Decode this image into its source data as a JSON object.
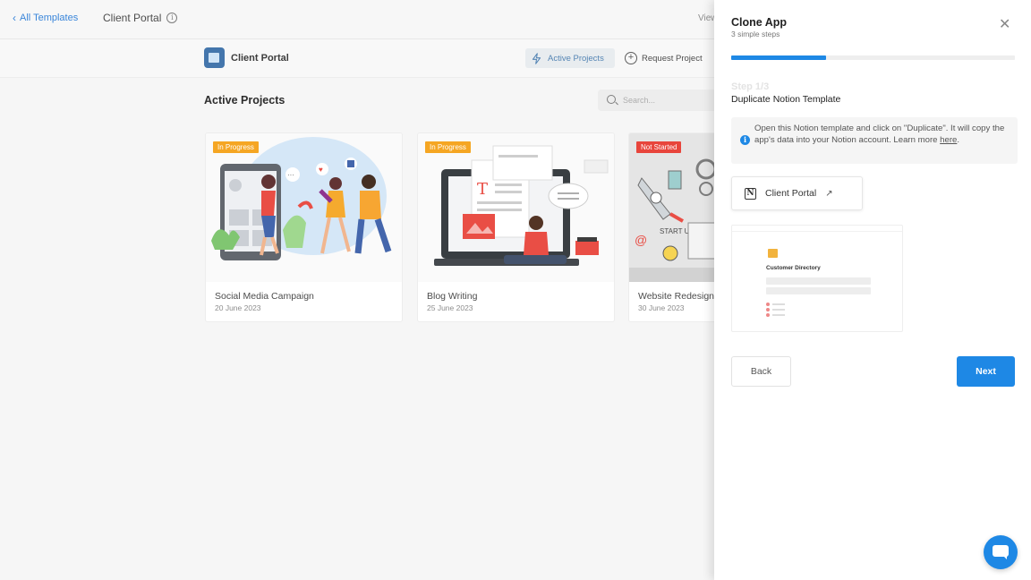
{
  "topbar": {
    "back_label": "All Templates",
    "title": "Client Portal",
    "view_label": "View"
  },
  "appbar": {
    "app_name": "Client Portal",
    "nav_active": "Active Projects",
    "nav_request": "Request Project"
  },
  "main": {
    "section_title": "Active Projects",
    "search_placeholder": "Search...",
    "cards": [
      {
        "badge": "In Progress",
        "badge_color": "#f5a623",
        "name": "Social Media Campaign",
        "date": "20 June 2023"
      },
      {
        "badge": "In Progress",
        "badge_color": "#f5a623",
        "name": "Blog Writing",
        "date": "25 June 2023"
      },
      {
        "badge": "Not Started",
        "badge_color": "#e8453c",
        "name": "Website Redesign",
        "date": "30 June 2023"
      }
    ]
  },
  "panel": {
    "title": "Clone App",
    "subtitle": "3 simple steps",
    "progress_fraction": 0.333,
    "step_label": "Step 1/3",
    "step_title": "Duplicate Notion Template",
    "info_text": "Open this Notion template and click on \"Duplicate\". It will copy the app's data into your Notion account. Learn more ",
    "info_link": "here",
    "info_end": ".",
    "notion_button": "Client Portal",
    "preview_title": "Customer Directory",
    "back_button": "Back",
    "next_button": "Next"
  },
  "colors": {
    "accent": "#1e88e5",
    "link": "#2f7fd8",
    "in_progress": "#f5a623",
    "not_started": "#e8453c"
  }
}
